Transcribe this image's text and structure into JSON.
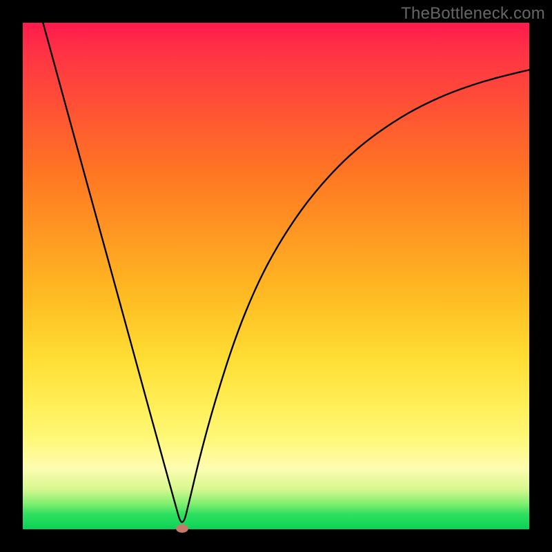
{
  "watermark": "TheBottleneck.com",
  "chart_data": {
    "type": "line",
    "title": "",
    "xlabel": "",
    "ylabel": "",
    "xlim": [
      0,
      1
    ],
    "ylim": [
      0,
      1
    ],
    "series": [
      {
        "name": "curve",
        "x": [
          0.04,
          0.06,
          0.08,
          0.1,
          0.12,
          0.14,
          0.16,
          0.18,
          0.2,
          0.22,
          0.24,
          0.26,
          0.28,
          0.3,
          0.315,
          0.33,
          0.35,
          0.38,
          0.42,
          0.46,
          0.5,
          0.55,
          0.6,
          0.65,
          0.7,
          0.76,
          0.82,
          0.88,
          0.94,
          1.0
        ],
        "y": [
          1.0,
          0.927,
          0.854,
          0.781,
          0.708,
          0.635,
          0.563,
          0.49,
          0.417,
          0.344,
          0.271,
          0.198,
          0.126,
          0.053,
          0.0,
          0.06,
          0.145,
          0.255,
          0.38,
          0.478,
          0.555,
          0.632,
          0.693,
          0.743,
          0.783,
          0.822,
          0.852,
          0.875,
          0.893,
          0.907
        ]
      }
    ],
    "marker": {
      "x": 0.315,
      "y": 0.002
    }
  },
  "colors": {
    "curve_stroke": "#000000",
    "marker_fill": "#c57a6a"
  }
}
